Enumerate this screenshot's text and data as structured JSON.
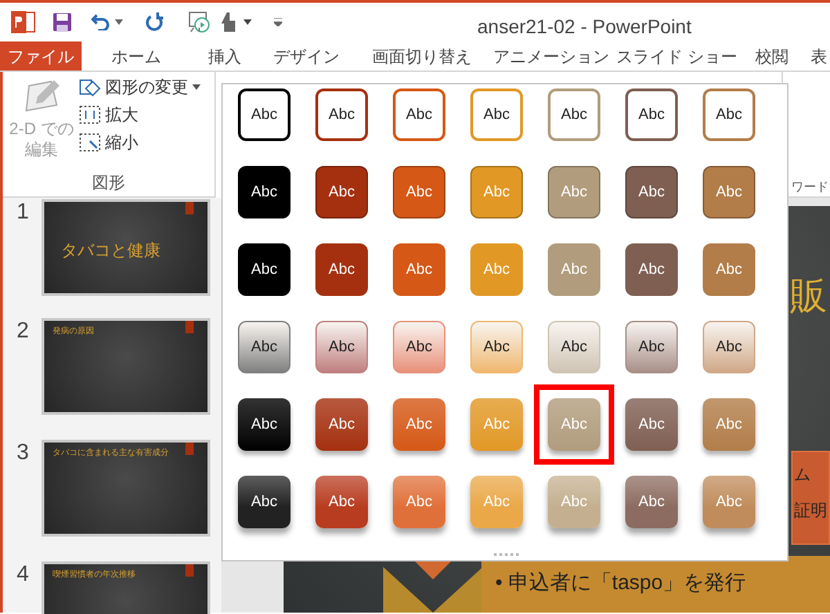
{
  "window": {
    "title": "anser21-02 - PowerPoint"
  },
  "tabs": [
    {
      "label": "ファイル",
      "kind": "file",
      "selected": false
    },
    {
      "label": "ホーム",
      "kind": "tab",
      "selected": false
    },
    {
      "label": "挿入",
      "kind": "tab",
      "selected": false
    },
    {
      "label": "デザイン",
      "kind": "tab",
      "selected": false
    },
    {
      "label": "画面切り替え",
      "kind": "tab",
      "selected": false
    },
    {
      "label": "アニメーション",
      "kind": "tab",
      "selected": false
    },
    {
      "label": "スライド ショー",
      "kind": "tab",
      "selected": false
    },
    {
      "label": "校閲",
      "kind": "tab",
      "selected": false
    },
    {
      "label": "表",
      "kind": "tab",
      "selected": false
    }
  ],
  "ribbon": {
    "edit_2d": {
      "lines": [
        "2-D での",
        "編集"
      ],
      "disabled": true
    },
    "items": [
      {
        "label": "図形の変更",
        "dropdown": true
      },
      {
        "label": "拡大",
        "dropdown": false
      },
      {
        "label": "縮小",
        "dropdown": false
      }
    ],
    "group_label": "図形",
    "side_label": "ワード"
  },
  "slides": [
    {
      "number": "1",
      "title": "タバコと健康"
    },
    {
      "number": "2",
      "title": "発病の原因"
    },
    {
      "number": "3",
      "title": "タバコに含まれる主な有害成分"
    },
    {
      "number": "4",
      "title": "喫煙習慣者の年次推移"
    }
  ],
  "gallery": {
    "rows": [
      {
        "kind": "outline",
        "swatches": [
          {
            "label": "Abc",
            "color": "#000000",
            "selected": false
          },
          {
            "label": "Abc",
            "color": "#a5300f",
            "selected": false
          },
          {
            "label": "Abc",
            "color": "#d55816",
            "selected": false
          },
          {
            "label": "Abc",
            "color": "#e19825",
            "selected": false
          },
          {
            "label": "Abc",
            "color": "#b19c7d",
            "selected": false
          },
          {
            "label": "Abc",
            "color": "#7f5f52",
            "selected": false
          },
          {
            "label": "Abc",
            "color": "#b27d49",
            "selected": false
          }
        ]
      },
      {
        "kind": "solid",
        "swatches": [
          {
            "label": "Abc",
            "color": "#000000",
            "selected": false
          },
          {
            "label": "Abc",
            "color": "#a5300f",
            "selected": false
          },
          {
            "label": "Abc",
            "color": "#d55816",
            "selected": false
          },
          {
            "label": "Abc",
            "color": "#e19825",
            "selected": false
          },
          {
            "label": "Abc",
            "color": "#b19c7d",
            "selected": false
          },
          {
            "label": "Abc",
            "color": "#7f5f52",
            "selected": false
          },
          {
            "label": "Abc",
            "color": "#b27d49",
            "selected": false
          }
        ]
      },
      {
        "kind": "flat",
        "swatches": [
          {
            "label": "Abc",
            "color": "#000000",
            "selected": false
          },
          {
            "label": "Abc",
            "color": "#a5300f",
            "selected": false
          },
          {
            "label": "Abc",
            "color": "#d55816",
            "selected": false
          },
          {
            "label": "Abc",
            "color": "#e19825",
            "selected": false
          },
          {
            "label": "Abc",
            "color": "#b19c7d",
            "selected": false
          },
          {
            "label": "Abc",
            "color": "#7f5f52",
            "selected": false
          },
          {
            "label": "Abc",
            "color": "#b27d49",
            "selected": false
          }
        ]
      },
      {
        "kind": "light",
        "swatches": [
          {
            "label": "Abc",
            "color": "#808080",
            "selected": false
          },
          {
            "label": "Abc",
            "color": "#c08080",
            "selected": false
          },
          {
            "label": "Abc",
            "color": "#e8907a",
            "selected": false
          },
          {
            "label": "Abc",
            "color": "#f0b870",
            "selected": false
          },
          {
            "label": "Abc",
            "color": "#cfc4b4",
            "selected": false
          },
          {
            "label": "Abc",
            "color": "#a89088",
            "selected": false
          },
          {
            "label": "Abc",
            "color": "#d0a888",
            "selected": false
          }
        ]
      },
      {
        "kind": "gradient",
        "swatches": [
          {
            "label": "Abc",
            "color": "#000000",
            "selected": false
          },
          {
            "label": "Abc",
            "color": "#a5300f",
            "selected": false
          },
          {
            "label": "Abc",
            "color": "#d55816",
            "selected": false
          },
          {
            "label": "Abc",
            "color": "#e19825",
            "selected": false
          },
          {
            "label": "Abc",
            "color": "#b19c7d",
            "selected": true
          },
          {
            "label": "Abc",
            "color": "#7f5f52",
            "selected": false
          },
          {
            "label": "Abc",
            "color": "#b27d49",
            "selected": false
          }
        ]
      },
      {
        "kind": "intense",
        "swatches": [
          {
            "label": "Abc",
            "color": "#222222",
            "selected": false
          },
          {
            "label": "Abc",
            "color": "#b83c20",
            "selected": false
          },
          {
            "label": "Abc",
            "color": "#e0703a",
            "selected": false
          },
          {
            "label": "Abc",
            "color": "#eaa848",
            "selected": false
          },
          {
            "label": "Abc",
            "color": "#c4b090",
            "selected": false
          },
          {
            "label": "Abc",
            "color": "#8c6c60",
            "selected": false
          },
          {
            "label": "Abc",
            "color": "#c08c5c",
            "selected": false
          }
        ]
      }
    ]
  },
  "slide": {
    "big_text": "販",
    "box_lines": [
      "ム",
      "証明"
    ],
    "banner": "• 申込者に「taspo」を発行"
  }
}
